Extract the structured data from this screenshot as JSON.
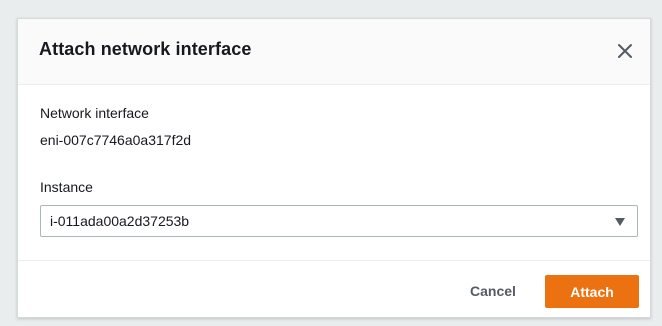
{
  "dialog": {
    "title": "Attach network interface",
    "close_icon": "close-icon"
  },
  "form": {
    "network_interface": {
      "label": "Network interface",
      "value": "eni-007c7746a0a317f2d"
    },
    "instance": {
      "label": "Instance",
      "selected_value": "i-011ada00a2d37253b",
      "caret_icon": "caret-down-icon"
    }
  },
  "footer": {
    "cancel_label": "Cancel",
    "attach_label": "Attach"
  },
  "colors": {
    "page_background": "#eaeded",
    "primary_button": "#ec7211",
    "text": "#16191f",
    "secondary_text": "#545b64",
    "input_border": "#aab7b8"
  }
}
